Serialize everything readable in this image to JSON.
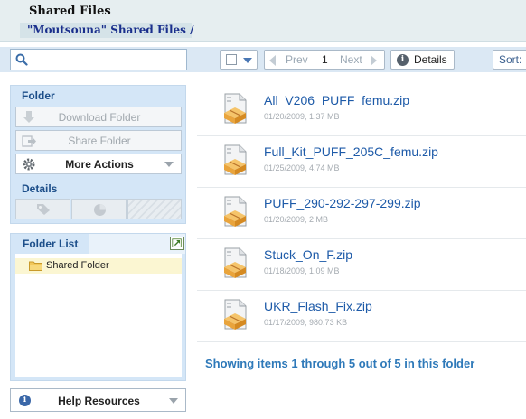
{
  "header": {
    "title": "Shared Files",
    "breadcrumb": "\"Moutsouna\" Shared Files /"
  },
  "toolbar": {
    "search_placeholder": "",
    "pager": {
      "prev": "Prev",
      "page": "1",
      "next": "Next"
    },
    "details_label": "Details",
    "sort_label": "Sort:"
  },
  "folder_panel": {
    "heading": "Folder",
    "download_label": "Download Folder",
    "share_label": "Share Folder",
    "more_actions_label": "More Actions",
    "details_heading": "Details"
  },
  "folder_list": {
    "heading": "Folder List",
    "items": [
      {
        "label": "Shared Folder",
        "selected": true
      }
    ]
  },
  "help": {
    "label": "Help Resources"
  },
  "files": [
    {
      "name": "All_V206_PUFF_femu.zip",
      "meta": "01/20/2009, 1.37 MB"
    },
    {
      "name": "Full_Kit_PUFF_205C_femu.zip",
      "meta": "01/25/2009, 4.74 MB"
    },
    {
      "name": "PUFF_290-292-297-299.zip",
      "meta": "01/20/2009, 2 MB"
    },
    {
      "name": "Stuck_On_F.zip",
      "meta": "01/18/2009, 1.09 MB"
    },
    {
      "name": "UKR_Flash_Fix.zip",
      "meta": "01/17/2009, 980.73 KB"
    }
  ],
  "summary": "Showing items 1 through 5 out of 5 in this folder",
  "colors": {
    "header_bg": "#e6eef0",
    "panel_bg": "#d4e6f7",
    "link_blue": "#1d5aa8",
    "heading_blue": "#1d4f8a",
    "folder_selected_bg": "#fbf6d2"
  }
}
